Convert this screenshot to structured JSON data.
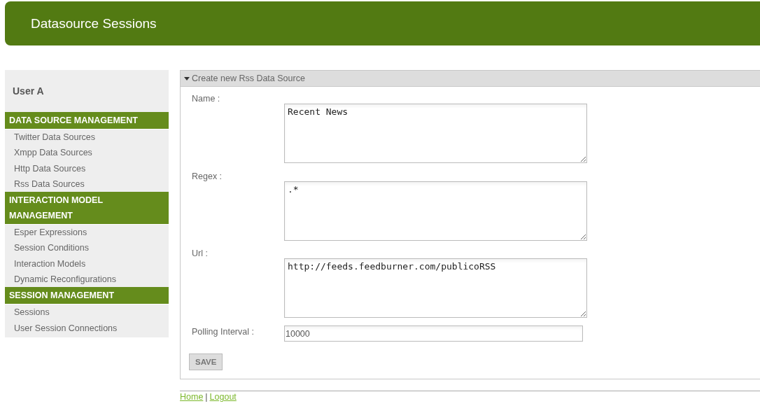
{
  "header": {
    "title": "Datasource Sessions"
  },
  "sidebar": {
    "user": "User A",
    "sections": [
      {
        "heading": "DATA SOURCE MANAGEMENT",
        "items": [
          "Twitter Data Sources",
          "Xmpp Data Sources",
          "Http Data Sources",
          "Rss Data Sources"
        ]
      },
      {
        "heading": "INTERACTION MODEL MANAGEMENT",
        "items": [
          "Esper Expressions",
          "Session Conditions",
          "Interaction Models",
          "Dynamic Reconfigurations"
        ]
      },
      {
        "heading": "SESSION MANAGEMENT",
        "items": [
          "Sessions",
          "User Session Connections"
        ]
      }
    ]
  },
  "panel": {
    "title": "Create new Rss Data Source",
    "expanded": true,
    "fields": [
      {
        "kind": "textarea",
        "label": "Name :",
        "value": "Recent News"
      },
      {
        "kind": "textarea",
        "label": "Regex :",
        "value": ".*"
      },
      {
        "kind": "textarea",
        "label": "Url :",
        "value": "http://feeds.feedburner.com/publicoRSS"
      },
      {
        "kind": "input",
        "label": "Polling Interval :",
        "value": "10000"
      }
    ],
    "button": "SAVE"
  },
  "footer": {
    "links": [
      "Home",
      "Logout"
    ],
    "separator": "|"
  }
}
